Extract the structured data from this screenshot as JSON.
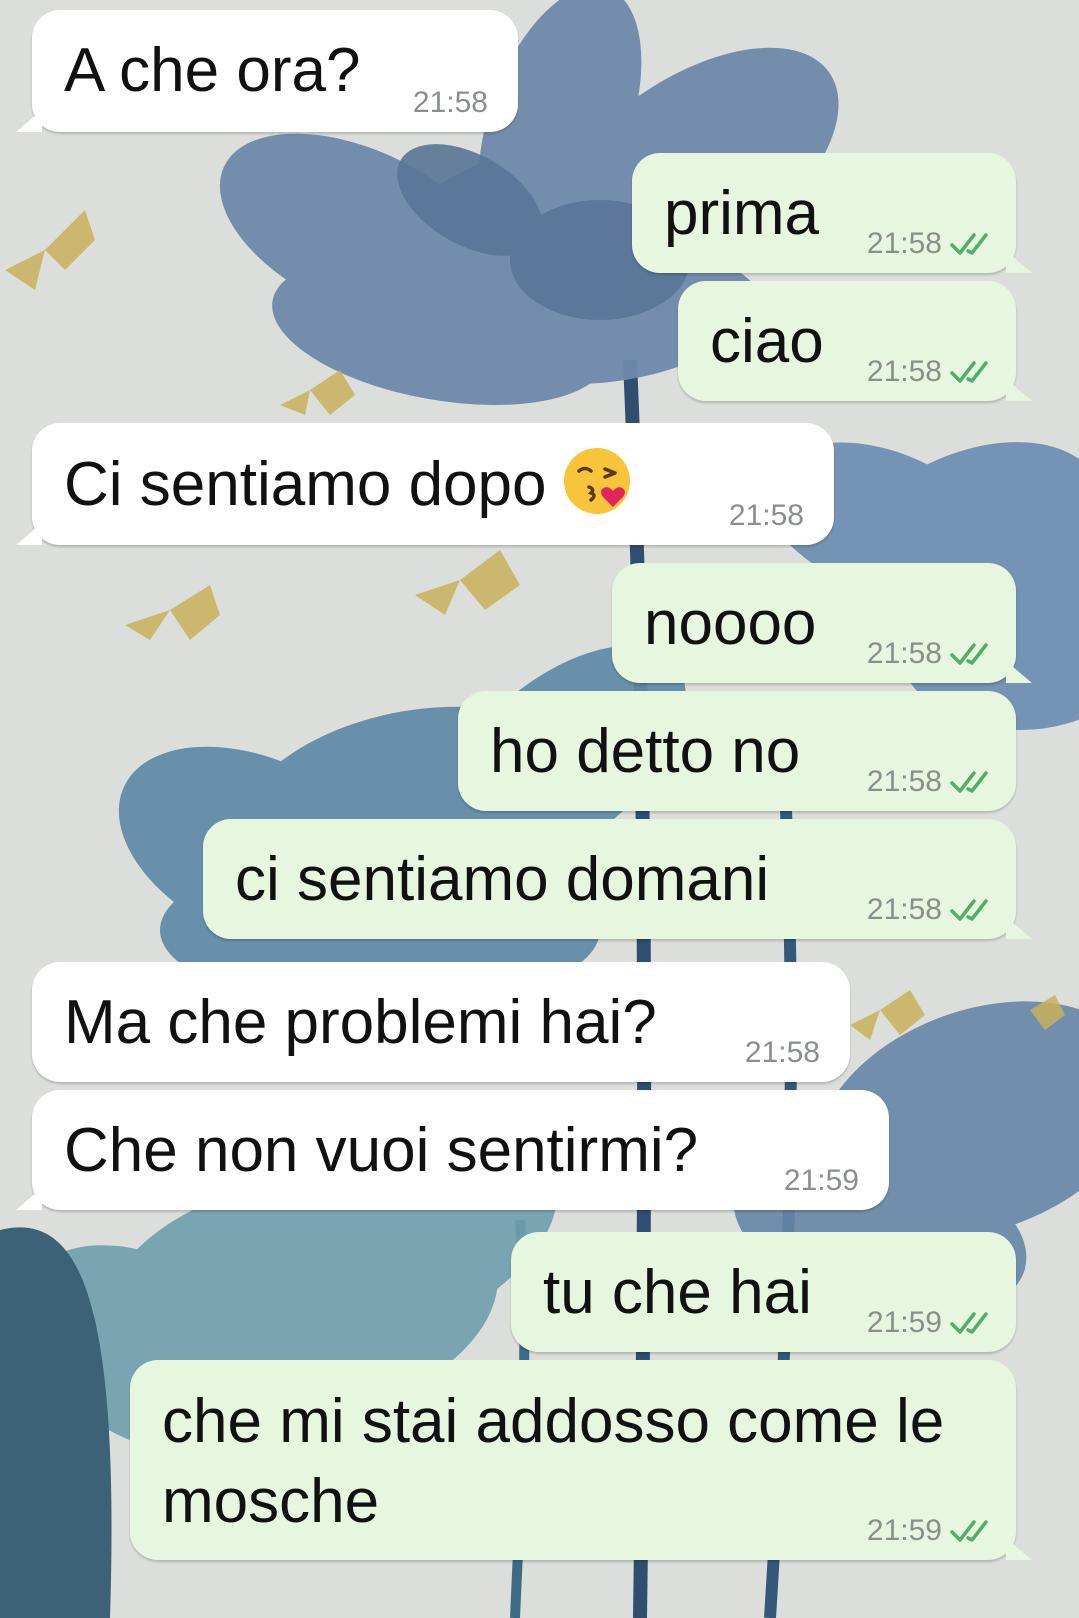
{
  "chat": {
    "messages": [
      {
        "direction": "in",
        "text": "A che ora?",
        "time": "21:58"
      },
      {
        "direction": "out",
        "text": "prima",
        "time": "21:58",
        "status": "read-double-check-icon"
      },
      {
        "direction": "out",
        "text": "ciao",
        "time": "21:58",
        "status": "read-double-check-icon"
      },
      {
        "direction": "in",
        "text": "Ci sentiamo dopo",
        "emoji": "face-blowing-kiss-emoji",
        "time": "21:58"
      },
      {
        "direction": "out",
        "text": "noooo",
        "time": "21:58",
        "status": "read-double-check-icon"
      },
      {
        "direction": "out",
        "text": "ho detto no",
        "time": "21:58",
        "status": "read-double-check-icon"
      },
      {
        "direction": "out",
        "text": "ci sentiamo domani",
        "time": "21:58",
        "status": "read-double-check-icon"
      },
      {
        "direction": "in",
        "text": "Ma che problemi hai?",
        "time": "21:58"
      },
      {
        "direction": "in",
        "text": "Che non vuoi sentirmi?",
        "time": "21:59"
      },
      {
        "direction": "out",
        "text": "tu che hai",
        "time": "21:59",
        "status": "read-double-check-icon"
      },
      {
        "direction": "out",
        "text": "che mi stai addosso come le mosche",
        "time": "21:59",
        "status": "read-double-check-icon"
      }
    ]
  },
  "colors": {
    "incoming_bubble": "#ffffff",
    "outgoing_bubble": "#e7f6df",
    "read_ticks": "#4fae6a",
    "timestamp": "#8a8f8c",
    "wallpaper_base": "#d9dcd8",
    "flower_blue": "#6f87a8",
    "butterfly_gold": "#c9b25a"
  }
}
